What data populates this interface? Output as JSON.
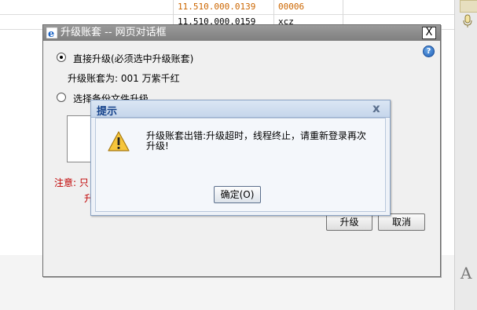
{
  "background": {
    "rows": [
      {
        "code": "11.510.000.0139",
        "value": "00006"
      },
      {
        "code": "11.510.000.0159",
        "value": "xcz"
      }
    ]
  },
  "dialog": {
    "title": "升级账套 -- 网页对话框",
    "close_label": "X",
    "help_label": "?",
    "option_direct_label": "直接升级(必须选中升级账套)",
    "target_text": "升级账套为: 001 万紫千红",
    "option_file_label": "选择备份文件升级",
    "note_line1": "注意: 只",
    "note_line2": "升",
    "upgrade_button": "升级",
    "cancel_button": "取消"
  },
  "message_box": {
    "title": "提示",
    "close_label": "x",
    "text": "升级账套出错:升级超时，线程终止，请重新登录再次升级!",
    "ok_button": "确定(O)"
  },
  "colors": {
    "note_red": "#c00000",
    "msg_title_text": "#15428b",
    "code_text": "#cc6600"
  },
  "icons": [
    "ie-icon",
    "help-icon",
    "warning-icon",
    "microphone-icon",
    "font-size-icon"
  ],
  "side_panel": {
    "font_label": "A"
  }
}
